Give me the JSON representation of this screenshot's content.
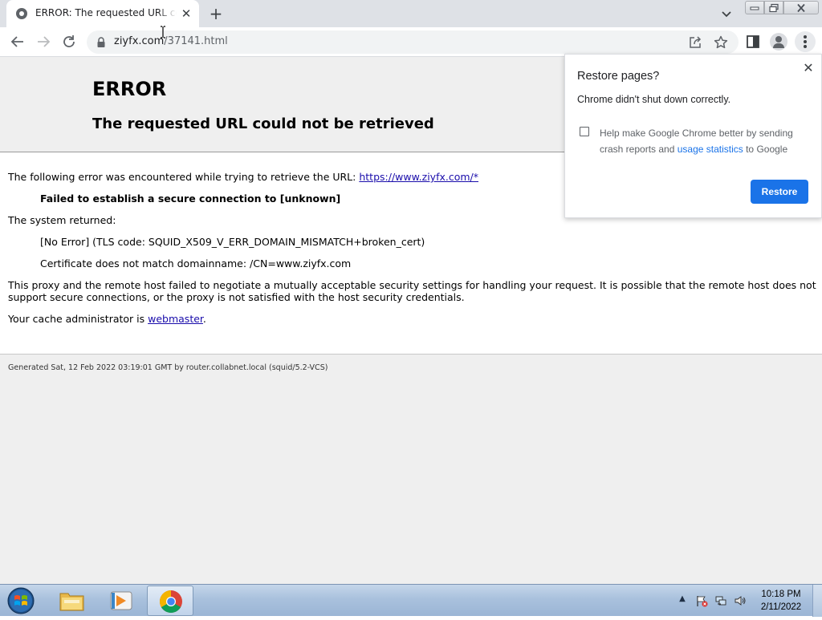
{
  "tab": {
    "title": "ERROR: The requested URL could not be retrieved",
    "close_glyph": "✕",
    "new_tab_glyph": "+"
  },
  "omnibox": {
    "url_domain": "ziyfx.com",
    "url_path": "/37141.html"
  },
  "page": {
    "heading": "ERROR",
    "subheading": "The requested URL could not be retrieved",
    "intro_text": "The following error was encountered while trying to retrieve the URL: ",
    "intro_link": "https://www.ziyfx.com/*",
    "error_bold": "Failed to establish a secure connection to [unknown]",
    "system_returned": "The system returned:",
    "tls_code": "[No Error] (TLS code: SQUID_X509_V_ERR_DOMAIN_MISMATCH+broken_cert)",
    "cert_mismatch": "Certificate does not match domainname: /CN=www.ziyfx.com",
    "explanation_1": "This proxy and the remote host failed to negotiate a mutually acceptable security settings for handling your request. It is possible that the remote host does not",
    "explanation_2": "support secure connections, or the proxy is not satisfied with the host security credentials.",
    "admin_text": "Your cache administrator is ",
    "admin_link": "webmaster",
    "admin_period": ".",
    "footer": "Generated Sat, 12 Feb 2022 03:19:01 GMT by router.collabnet.local (squid/5.2-VCS)"
  },
  "restore_bubble": {
    "title": "Restore pages?",
    "message": "Chrome didn't shut down correctly.",
    "checkbox_text_1": "Help make Google Chrome better by sending",
    "checkbox_text_2": "crash reports and ",
    "checkbox_link": "usage statistics",
    "checkbox_text_3": " to Google",
    "button_label": "Restore",
    "close_glyph": "✕",
    "checked": false
  },
  "taskbar": {
    "time": "10:18 PM",
    "date": "2/11/2022",
    "tray_arrow_glyph": "▲"
  },
  "colors": {
    "accent": "#1a73e8",
    "link": "#1a0dab",
    "page_background": "#efefef"
  },
  "icons": {
    "tab_favicon": "globe-icon",
    "back": "back-arrow-icon",
    "forward": "forward-arrow-icon",
    "reload": "reload-icon",
    "lock": "lock-icon",
    "share": "share-icon",
    "bookmark": "star-icon",
    "side_panel": "side-panel-icon",
    "profile": "profile-icon",
    "menu": "kebab-menu-icon"
  }
}
